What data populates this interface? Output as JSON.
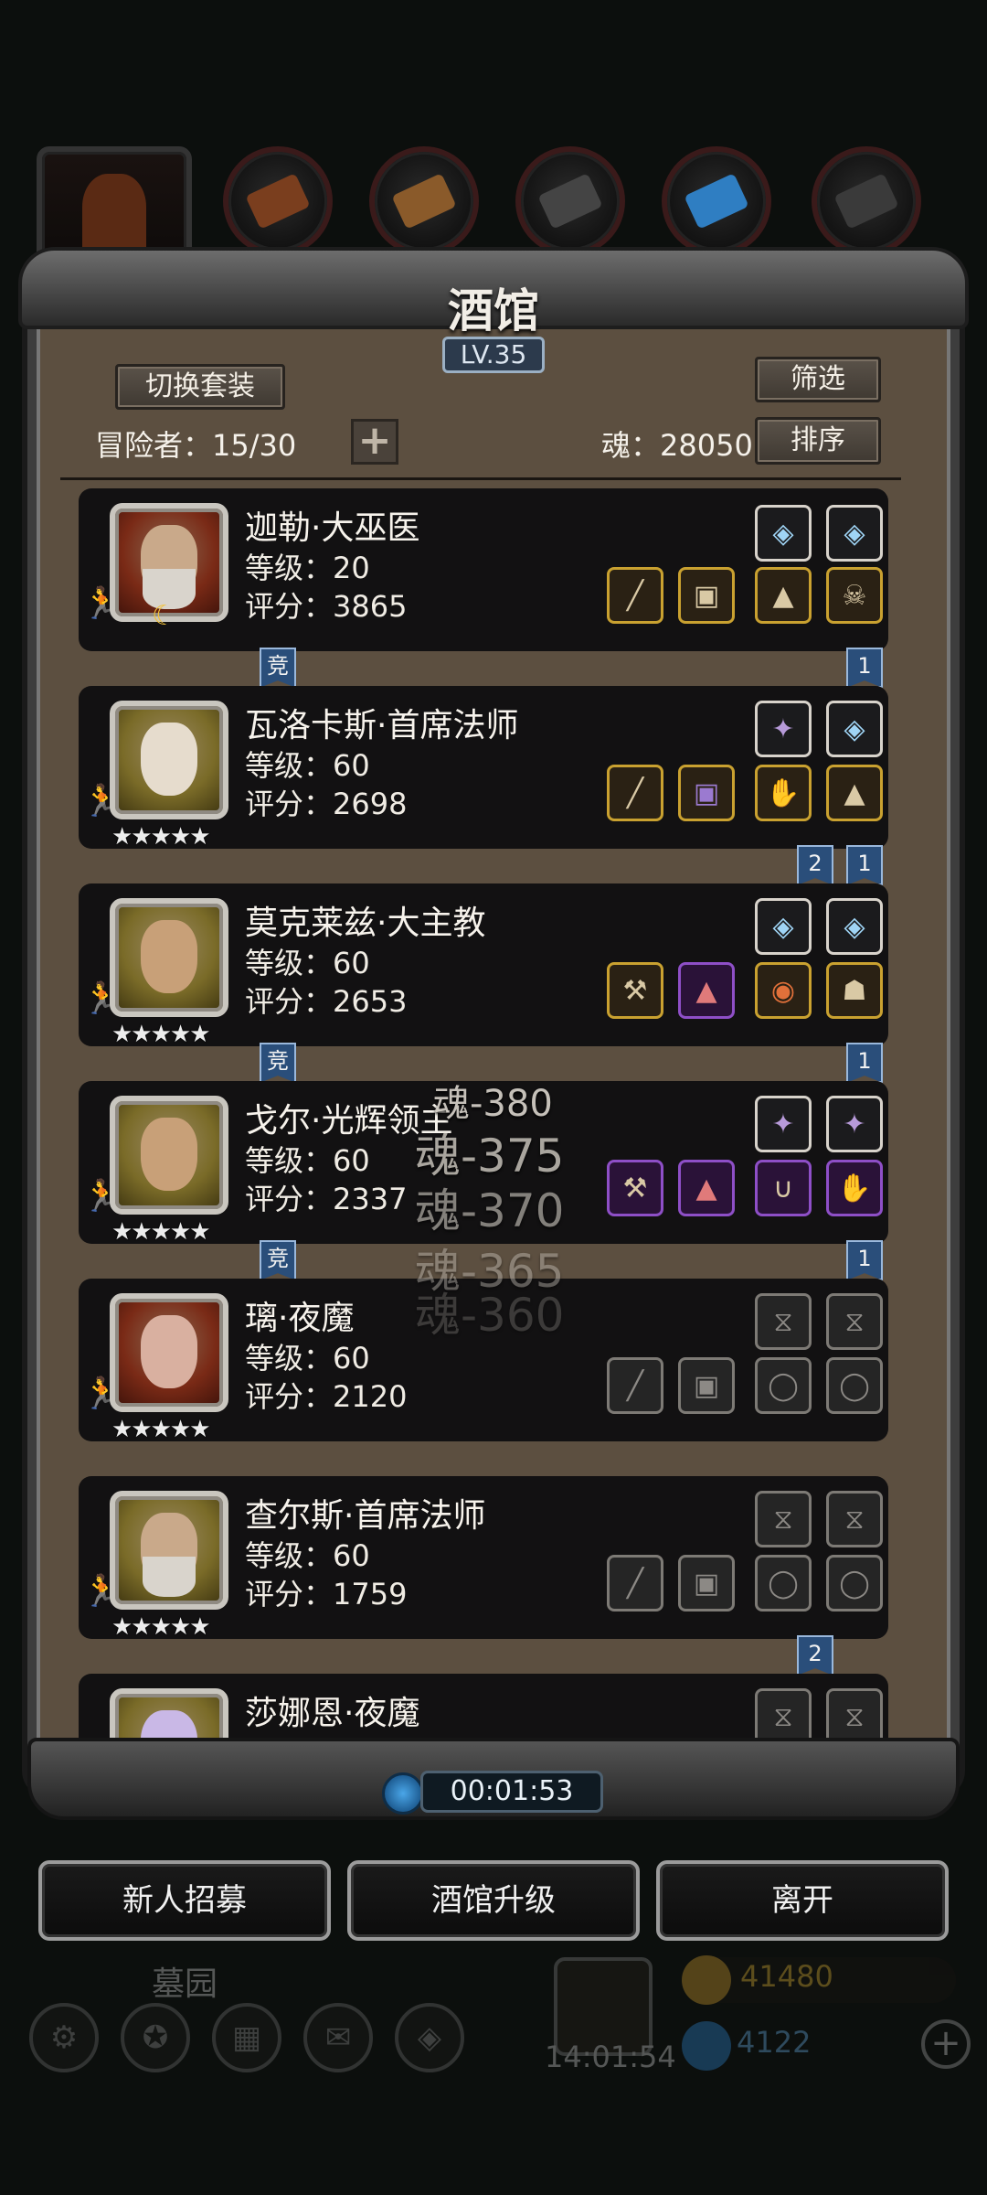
{
  "tavern": {
    "title": "酒馆",
    "level": "LV.35",
    "switch_outfit_label": "切换套装",
    "filter_label": "筛选",
    "sort_label": "排序",
    "adventurers_label": "冒险者：15/30",
    "soul_label": "魂：28050",
    "add_symbol": "+"
  },
  "heroes": [
    {
      "name": "迦勒·大巫医",
      "level": "等级：20",
      "score": "评分：3865",
      "stars": "",
      "tags": [
        "竞",
        "1"
      ],
      "moon": "☾"
    },
    {
      "name": "瓦洛卡斯·首席法师",
      "level": "等级：60",
      "score": "评分：2698",
      "stars": "★★★★★",
      "tags": [
        "2",
        "1"
      ]
    },
    {
      "name": "莫克莱兹·大主教",
      "level": "等级：60",
      "score": "评分：2653",
      "stars": "★★★★★",
      "tags": [
        "竞",
        "1"
      ]
    },
    {
      "name": "戈尔·光辉领主",
      "level": "等级：60",
      "score": "评分：2337",
      "stars": "★★★★★",
      "tags": [
        "竞",
        "1"
      ]
    },
    {
      "name": "璃·夜魔",
      "level": "等级：60",
      "score": "评分：2120",
      "stars": "★★★★★",
      "tags": []
    },
    {
      "name": "查尔斯·首席法师",
      "level": "等级：60",
      "score": "评分：1759",
      "stars": "★★★★★",
      "tags": [
        "2"
      ]
    },
    {
      "name": "莎娜恩·夜魔",
      "level": "",
      "score": "",
      "stars": "",
      "tags": []
    }
  ],
  "floating_soul": [
    "魂-380",
    "魂-375",
    "魂-370",
    "魂-365",
    "魂-360"
  ],
  "timer": "00:01:53",
  "bottom_buttons": {
    "recruit": "新人招募",
    "upgrade": "酒馆升级",
    "leave": "离开"
  },
  "background_ui": {
    "area_name": "墓园",
    "gold": "41480",
    "gems": "4122",
    "clock": "14:01:54"
  },
  "icons": {
    "plus": "plus-icon",
    "clock": "clock-icon",
    "star": "star-icon"
  },
  "colors": {
    "frame": "#5c4f40",
    "card": "#121112",
    "tag": "#2a4e7a",
    "gold_slot": "#c9a130",
    "purple_slot": "#8e4fc7"
  }
}
